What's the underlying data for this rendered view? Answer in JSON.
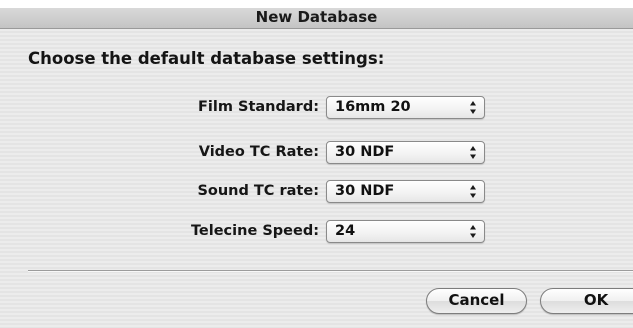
{
  "window": {
    "title": "New Database"
  },
  "dialog": {
    "heading": "Choose the default database settings:",
    "fields": [
      {
        "label": "Film Standard:",
        "value": "16mm 20"
      },
      {
        "label": "Video TC Rate:",
        "value": "30 NDF"
      },
      {
        "label": "Sound TC rate:",
        "value": "30 NDF"
      },
      {
        "label": "Telecine Speed:",
        "value": "24"
      }
    ],
    "buttons": {
      "cancel_label": "Cancel",
      "ok_label": "OK"
    }
  },
  "icons": {
    "popup_arrows": "up-down-arrows-icon"
  }
}
